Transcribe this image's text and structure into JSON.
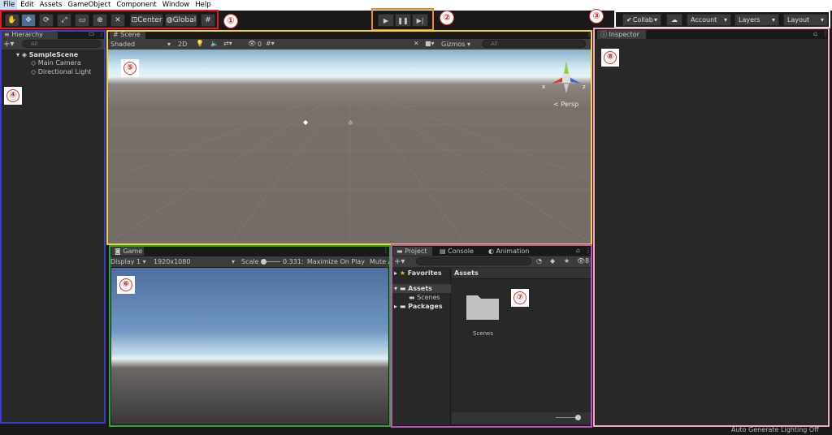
{
  "menu": [
    "File",
    "Edit",
    "Assets",
    "GameObject",
    "Component",
    "Window",
    "Help"
  ],
  "toolbar": {
    "center": "Center",
    "global": "Global",
    "collab": "Collab",
    "account": "Account",
    "layers": "Layers",
    "layout": "Layout"
  },
  "markers": [
    "①",
    "②",
    "③",
    "④",
    "⑤",
    "⑥",
    "⑦",
    "⑧"
  ],
  "hierarchy": {
    "tab": "Hierarchy",
    "search": "All",
    "scene": "SampleScene",
    "items": [
      "Main Camera",
      "Directional Light"
    ]
  },
  "scene": {
    "tab": "Scene",
    "shading": "Shaded",
    "mode2d": "2D",
    "layers_count": "0",
    "gizmos": "Gizmos",
    "search": "All",
    "persp": "Persp",
    "axis_x": "x",
    "axis_z": "z"
  },
  "game": {
    "tab": "Game",
    "display": "Display 1",
    "resolution": "1920x1080",
    "scale_label": "Scale",
    "scale_value": "0.331:",
    "maximize": "Maximize On Play",
    "mute": "Mute A"
  },
  "project": {
    "tabs": [
      "Project",
      "Console",
      "Animation"
    ],
    "favorites": "Favorites",
    "assets": "Assets",
    "scenes": "Scenes",
    "packages": "Packages",
    "header": "Assets",
    "folder": "Scenes"
  },
  "inspector": {
    "tab": "Inspector"
  },
  "status": "Auto Generate Lighting Off",
  "colors": {
    "outline1": "#e02020",
    "outline2": "#f08a24",
    "outline3": "#ffffff",
    "outline4": "#3d3dcc",
    "outline5": "#f2d42e",
    "outline6": "#2aa83a",
    "outline7": "#c04ec0",
    "outline8": "#f3a8c0"
  }
}
